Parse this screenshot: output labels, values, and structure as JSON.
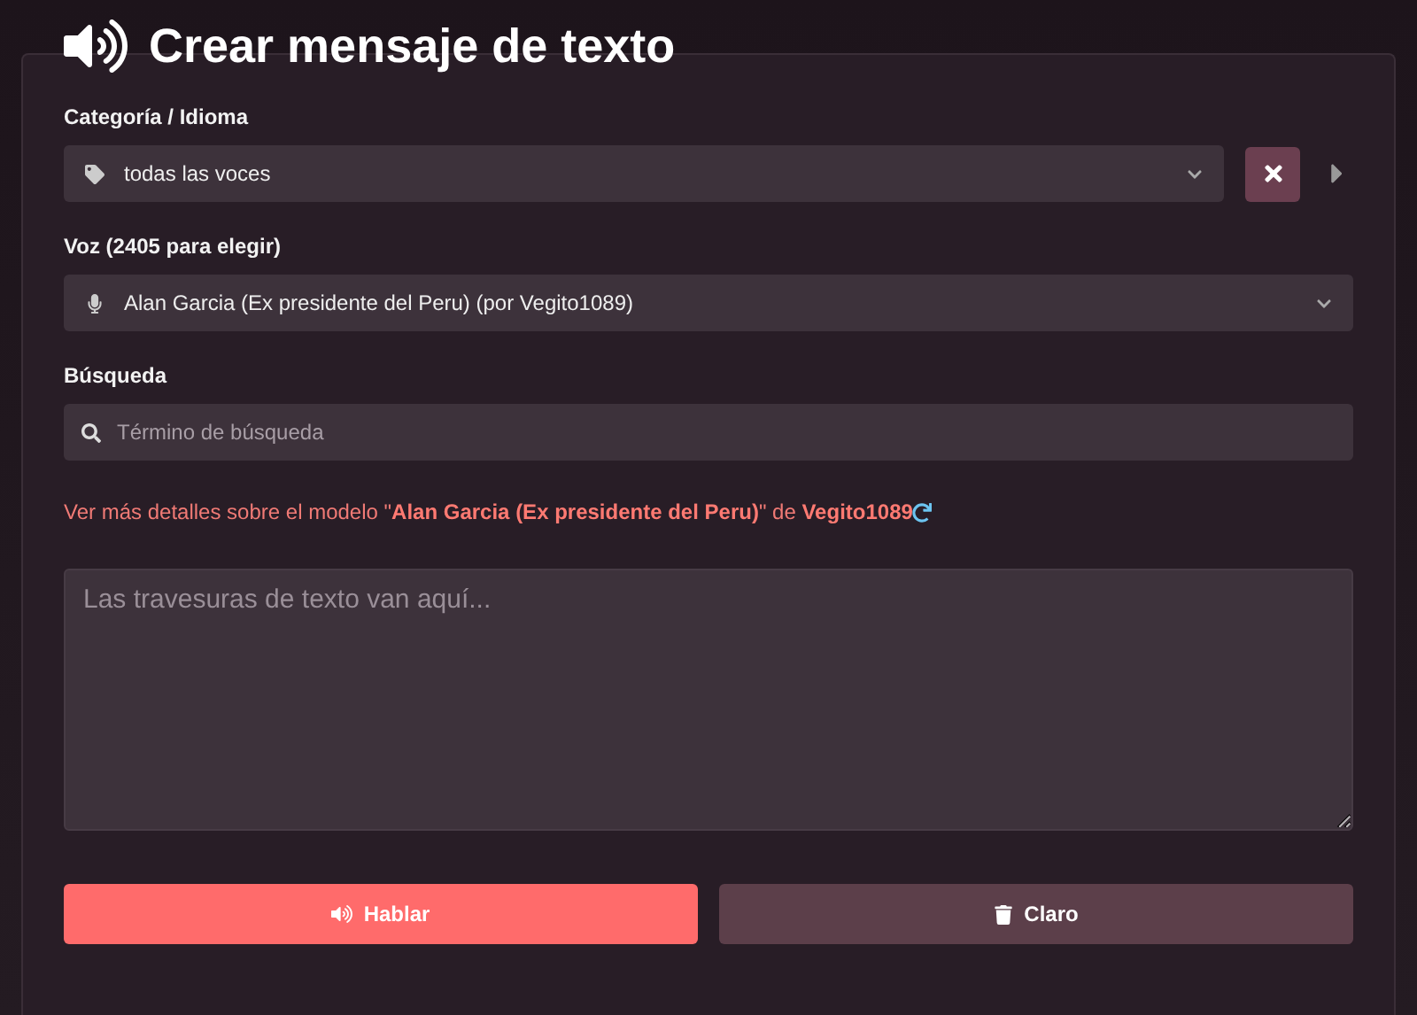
{
  "title": "Crear mensaje de texto",
  "category": {
    "label": "Categoría / Idioma",
    "value": "todas las voces"
  },
  "voice": {
    "label": "Voz (2405 para elegir)",
    "value": "Alan Garcia (Ex presidente del Peru) (por Vegito1089)"
  },
  "search": {
    "label": "Búsqueda",
    "placeholder": "Término de búsqueda"
  },
  "details": {
    "prefix": "Ver más detalles sobre el modelo \"",
    "model_link": "Alan Garcia (Ex presidente del Peru)",
    "separator": "\" de ",
    "author_link": "Vegito1089"
  },
  "message": {
    "placeholder": "Las travesuras de texto van aquí..."
  },
  "buttons": [
    {
      "label": "Hablar",
      "kind": "speak"
    },
    {
      "label": "Claro",
      "kind": "clear"
    }
  ]
}
